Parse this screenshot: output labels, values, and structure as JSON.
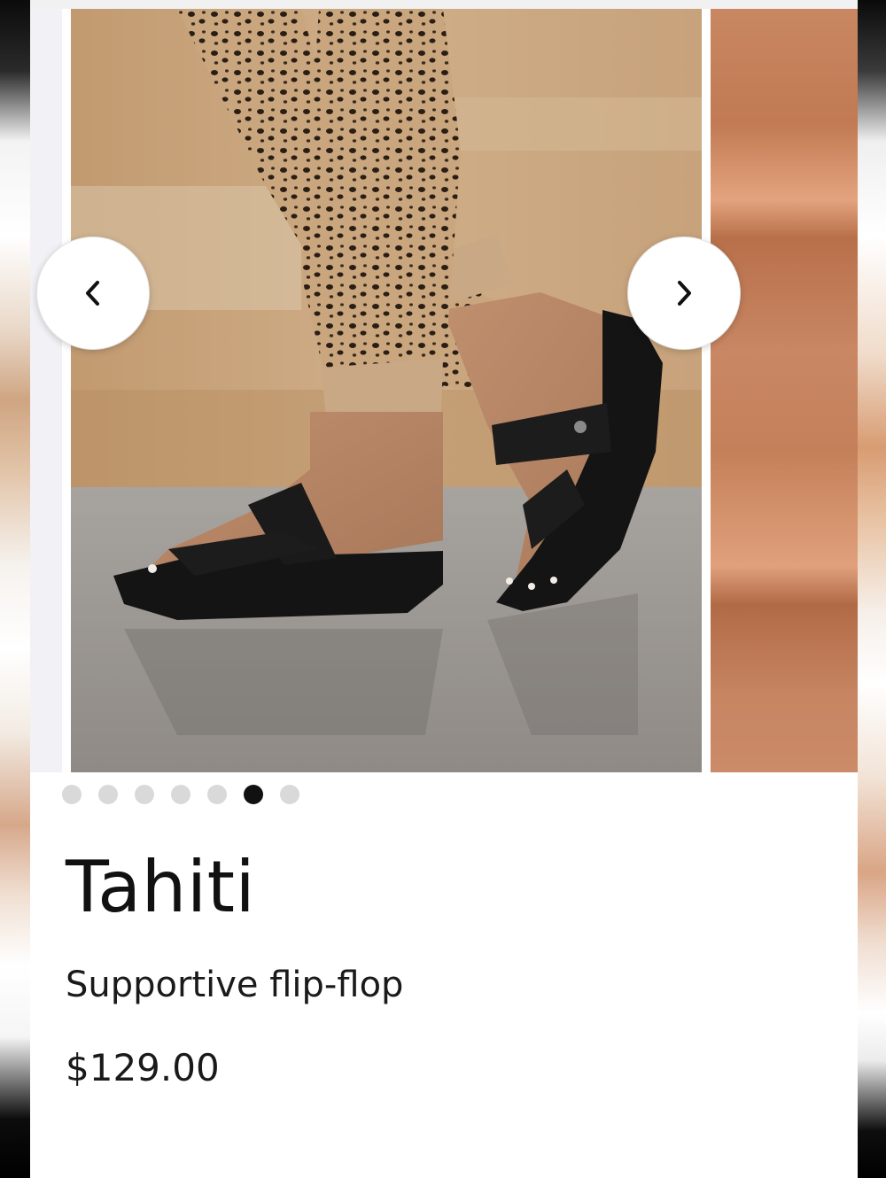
{
  "carousel": {
    "prev_icon": "chevron-left-icon",
    "next_icon": "chevron-right-icon",
    "slide_count": 7,
    "active_index": 5
  },
  "product": {
    "name": "Tahiti",
    "description": "Supportive flip-flop",
    "price": "$129.00"
  },
  "colors": {
    "dot_active": "#111111",
    "dot_inactive": "#d9d9d9",
    "text": "#111111"
  }
}
